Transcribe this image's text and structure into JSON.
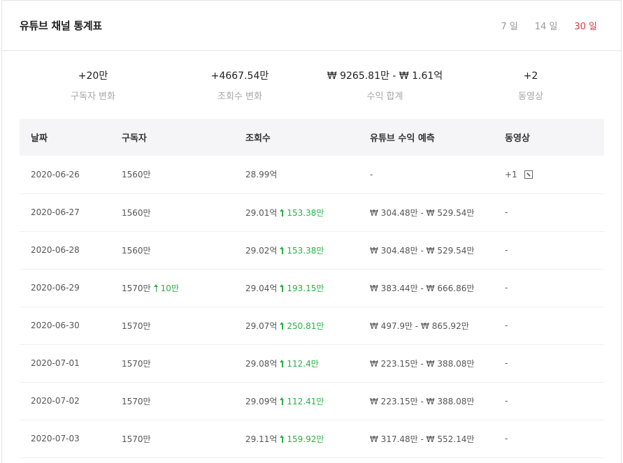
{
  "header": {
    "title": "유튜브 채널 통계표",
    "periods": [
      {
        "label": "7 일",
        "active": false
      },
      {
        "label": "14 일",
        "active": false
      },
      {
        "label": "30 일",
        "active": true
      }
    ]
  },
  "summary": [
    {
      "value": "+20만",
      "label": "구독자 변화"
    },
    {
      "value": "+4667.54만",
      "label": "조회수 변화"
    },
    {
      "value": "₩ 9265.81만 - ₩ 1.61억",
      "label": "수익 합계"
    },
    {
      "value": "+2",
      "label": "동영상"
    }
  ],
  "table": {
    "columns": [
      "날짜",
      "구독자",
      "조회수",
      "유튜브 수익 예측",
      "동영상"
    ],
    "rows": [
      {
        "date": "2020-06-26",
        "subs": "1560만",
        "subs_delta": "",
        "views": "28.99억",
        "views_delta": "",
        "revenue": "-",
        "videos": "+1",
        "video_link": true
      },
      {
        "date": "2020-06-27",
        "subs": "1560만",
        "subs_delta": "",
        "views": "29.01억",
        "views_delta": "153.38만",
        "revenue": "₩ 304.48만 - ₩ 529.54만",
        "videos": "-",
        "video_link": false
      },
      {
        "date": "2020-06-28",
        "subs": "1560만",
        "subs_delta": "",
        "views": "29.02억",
        "views_delta": "153.38만",
        "revenue": "₩ 304.48만 - ₩ 529.54만",
        "videos": "-",
        "video_link": false
      },
      {
        "date": "2020-06-29",
        "subs": "1570만",
        "subs_delta": "10만",
        "views": "29.04억",
        "views_delta": "193.15만",
        "revenue": "₩ 383.44만 - ₩ 666.86만",
        "videos": "-",
        "video_link": false
      },
      {
        "date": "2020-06-30",
        "subs": "1570만",
        "subs_delta": "",
        "views": "29.07억",
        "views_delta": "250.81만",
        "revenue": "₩ 497.9만 - ₩ 865.92만",
        "videos": "-",
        "video_link": false
      },
      {
        "date": "2020-07-01",
        "subs": "1570만",
        "subs_delta": "",
        "views": "29.08억",
        "views_delta": "112.4만",
        "revenue": "₩ 223.15만 - ₩ 388.08만",
        "videos": "-",
        "video_link": false
      },
      {
        "date": "2020-07-02",
        "subs": "1570만",
        "subs_delta": "",
        "views": "29.09억",
        "views_delta": "112.41만",
        "revenue": "₩ 223.15만 - ₩ 388.08만",
        "videos": "-",
        "video_link": false
      },
      {
        "date": "2020-07-03",
        "subs": "1570만",
        "subs_delta": "",
        "views": "29.11억",
        "views_delta": "159.92만",
        "revenue": "₩ 317.48만 - ₩ 552.14만",
        "videos": "-",
        "video_link": false
      }
    ]
  },
  "colors": {
    "active_tab": "#e0393e",
    "increase": "#27b245",
    "header_bg": "#f5f5f7"
  },
  "icons": {
    "increase": "arrow-up-icon",
    "video_link": "external-link-icon"
  }
}
